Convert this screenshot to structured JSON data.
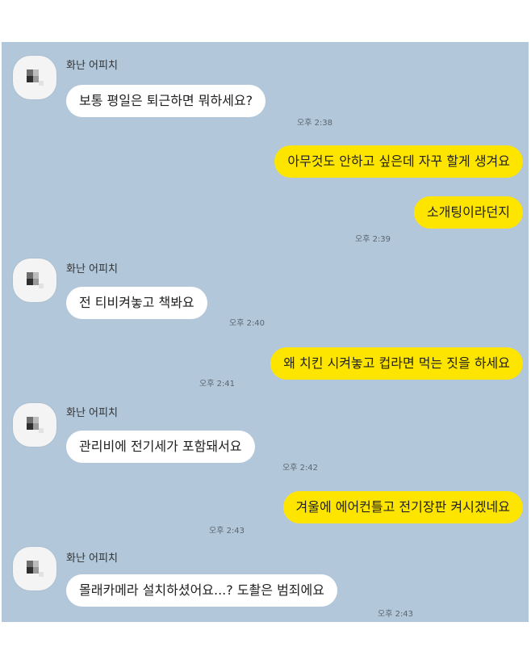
{
  "chat": {
    "sender_name": "화난 어피치",
    "messages": [
      {
        "side": "in",
        "text": "보통 평일은 퇴근하면 뭐하세요?",
        "time": "오후 2:38"
      },
      {
        "side": "out",
        "text": "아무것도 안하고 싶은데 자꾸 할게 생겨요",
        "time": ""
      },
      {
        "side": "out",
        "text": "소개팅이라던지",
        "time": "오후 2:39"
      },
      {
        "side": "in",
        "text": "전 티비켜놓고 책봐요",
        "time": "오후 2:40"
      },
      {
        "side": "out",
        "text": "왜 치킨 시켜놓고 컵라면 먹는 짓을 하세요",
        "time": "오후 2:41"
      },
      {
        "side": "in",
        "text": "관리비에 전기세가 포함돼서요",
        "time": "오후 2:42"
      },
      {
        "side": "out",
        "text": "겨울에 에어컨틀고 전기장판 켜시겠네요",
        "time": "오후 2:43"
      },
      {
        "side": "in",
        "text": "몰래카메라 설치하셨어요...? 도촬은 범죄에요",
        "time": "오후 2:43"
      }
    ]
  },
  "colors": {
    "background": "#b2c7d9",
    "incoming_bubble": "#ffffff",
    "outgoing_bubble": "#fee500"
  }
}
